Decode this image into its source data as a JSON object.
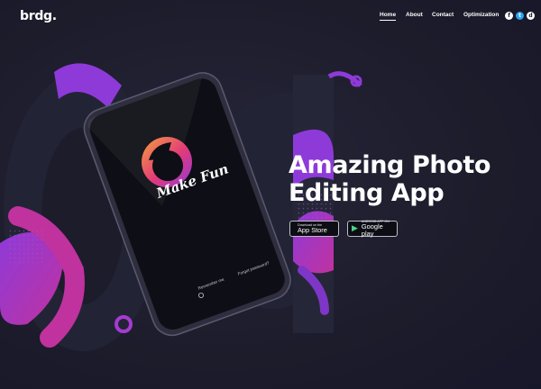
{
  "brand": {
    "logo_text": "brdg."
  },
  "nav": {
    "items": [
      {
        "label": "Home",
        "active": true
      },
      {
        "label": "About",
        "active": false
      },
      {
        "label": "Contact",
        "active": false
      },
      {
        "label": "Optimization",
        "active": false
      }
    ]
  },
  "socials": [
    {
      "icon": "facebook-icon",
      "glyph": "f"
    },
    {
      "icon": "twitter-icon",
      "glyph": "t"
    },
    {
      "icon": "dribbble-icon",
      "glyph": "d"
    }
  ],
  "hero": {
    "headline_line1": "Amazing Photo",
    "headline_line2": "Editing App",
    "app_store": {
      "small": "Download on the",
      "large": "App Store",
      "icon": "apple-icon"
    },
    "google_play": {
      "small": "ANDROID APP ON",
      "large": "Google play",
      "icon": "play-icon"
    }
  },
  "phone": {
    "logo_text": "Make Fun",
    "remember_label": "Remember me",
    "forgot_label": "Forgot password?"
  },
  "colors": {
    "background": "#1c1c2b",
    "accent_purple": "#8e3ad9",
    "accent_magenta": "#c0329e",
    "accent_orange": "#f08a3b"
  }
}
